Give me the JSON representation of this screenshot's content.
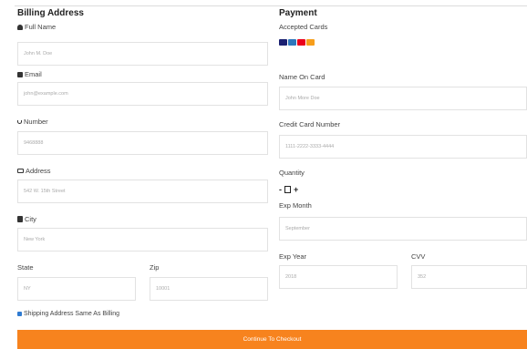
{
  "billing": {
    "heading": "Billing Address",
    "fullname": {
      "label": "Full Name",
      "placeholder": "John M. Doe"
    },
    "email": {
      "label": "Email",
      "placeholder": "john@example.com"
    },
    "number": {
      "label": "Number",
      "placeholder": "9468888"
    },
    "address": {
      "label": "Address",
      "placeholder": "542 W. 15th Street"
    },
    "city": {
      "label": "City",
      "placeholder": "New York"
    },
    "state": {
      "label": "State",
      "placeholder": "NY"
    },
    "zip": {
      "label": "Zip",
      "placeholder": "10001"
    },
    "same_as_billing": "Shipping Address Same As Billing"
  },
  "payment": {
    "heading": "Payment",
    "accepted_cards_label": "Accepted Cards",
    "card_colors": [
      "#1a1f71",
      "#2e77bc",
      "#eb001b",
      "#f79e1b"
    ],
    "name_on_card": {
      "label": "Name On Card",
      "placeholder": "John More Doe"
    },
    "card_number": {
      "label": "Credit Card Number",
      "placeholder": "1111-2222-3333-4444"
    },
    "quantity": {
      "label": "Quantity",
      "minus": "-",
      "plus": "+"
    },
    "exp_month": {
      "label": "Exp Month",
      "placeholder": "September"
    },
    "exp_year": {
      "label": "Exp Year",
      "placeholder": "2018"
    },
    "cvv": {
      "label": "CVV",
      "placeholder": "352"
    }
  },
  "submit_label": "Continue To Checkout",
  "accent": "#f7831e"
}
